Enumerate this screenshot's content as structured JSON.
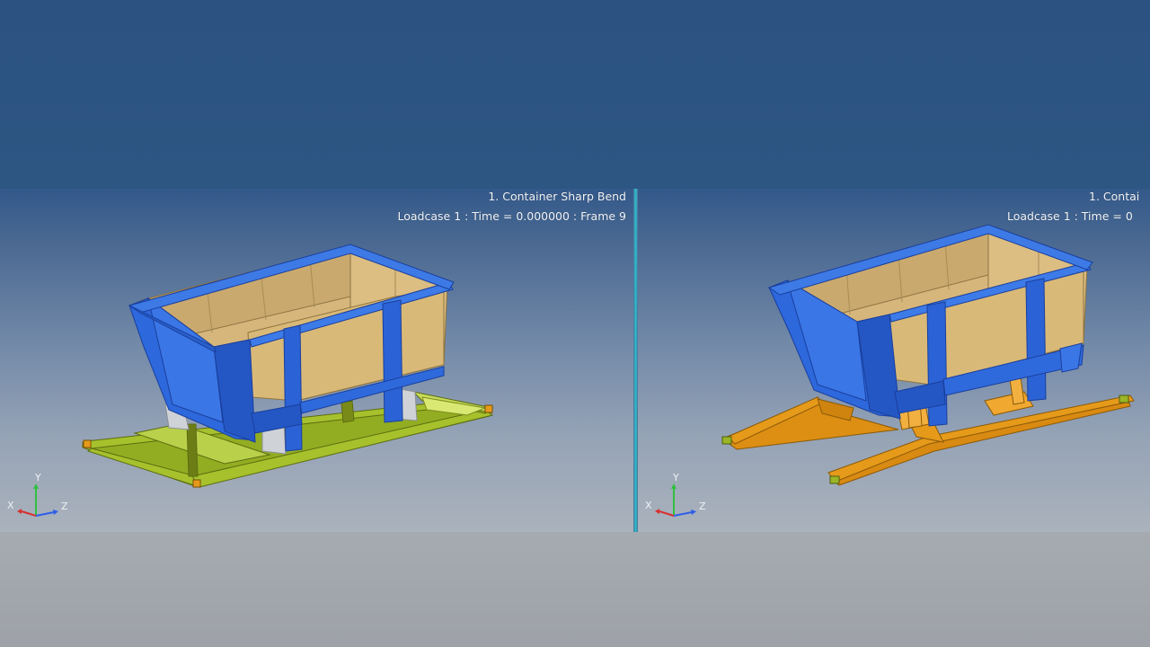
{
  "viewports": [
    {
      "title_line1": "1. Container Sharp Bend",
      "title_line2": "Loadcase 1 : Time = 0.000000 : Frame 9"
    },
    {
      "title_line1": "1. Contai",
      "title_line2": "Loadcase 1 : Time = 0"
    }
  ],
  "axis_labels": {
    "x": "X",
    "y": "Y",
    "z": "Z"
  },
  "colors": {
    "background": "#2c5482",
    "container_shell": "#2a66d9",
    "container_inner": "#d2b277",
    "frame_left": "#9ab526",
    "frame_right": "#e69a1a",
    "divider": "#2fb6c9",
    "axis_x": "#d83030",
    "axis_y": "#30c040",
    "axis_z": "#2f5ee8"
  }
}
